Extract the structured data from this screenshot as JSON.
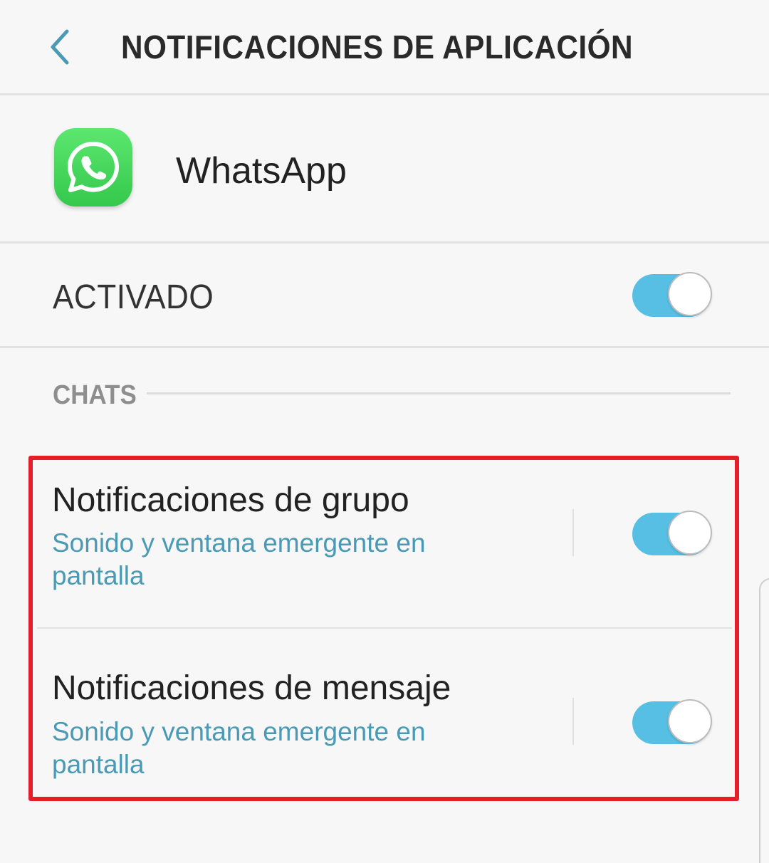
{
  "header": {
    "title": "NOTIFICACIONES DE APLICACIÓN",
    "back_icon": "chevron-left-icon"
  },
  "app": {
    "name": "WhatsApp",
    "icon": "whatsapp-logo-icon",
    "icon_color": "#3fd35a"
  },
  "main_toggle": {
    "label": "ACTIVADO",
    "on": true
  },
  "section": {
    "label": "CHATS"
  },
  "settings": [
    {
      "title": "Notificaciones de grupo",
      "subtitle": "Sonido y ventana emergente en pantalla",
      "on": true
    },
    {
      "title": "Notificaciones de mensaje",
      "subtitle": "Sonido y ventana emergente en pantalla",
      "on": true
    }
  ],
  "colors": {
    "accent": "#56bfe3",
    "subtitle": "#4a9ab5",
    "highlight": "#e41e2a",
    "background": "#f7f7f7"
  }
}
